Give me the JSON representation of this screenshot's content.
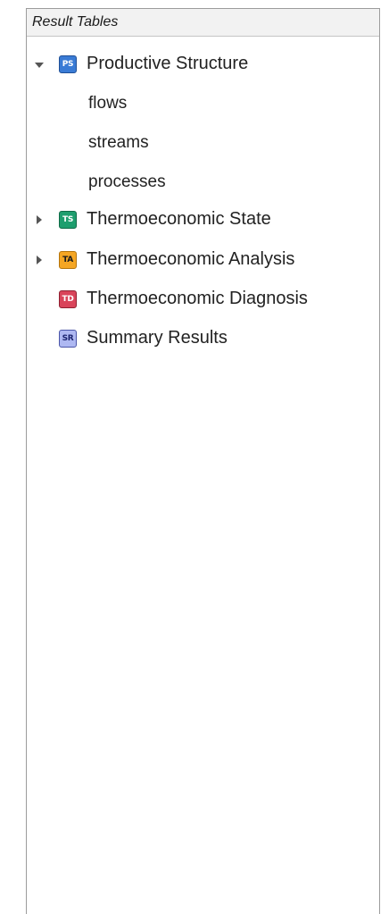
{
  "panel": {
    "title": "Result Tables"
  },
  "tree": {
    "productive_structure": {
      "badge": "PS",
      "label": "Productive Structure",
      "badge_bg": "#3a7bd5",
      "badge_border": "#1f4f96",
      "badge_fg": "#ffffff",
      "expanded": true,
      "children": [
        "flows",
        "streams",
        "processes"
      ]
    },
    "thermoeconomic_state": {
      "badge": "TS",
      "label": "Thermoeconomic State",
      "badge_bg": "#1e9e6e",
      "badge_border": "#0f6b47",
      "badge_fg": "#ffffff",
      "expanded": false
    },
    "thermoeconomic_analysis": {
      "badge": "TA",
      "label": "Thermoeconomic Analysis",
      "badge_bg": "#f5a623",
      "badge_border": "#b5740a",
      "badge_fg": "#1a1a1a",
      "expanded": false
    },
    "thermoeconomic_diagnosis": {
      "badge": "TD",
      "label": "Thermoeconomic Diagnosis",
      "badge_bg": "#d9445a",
      "badge_border": "#8f1f30",
      "badge_fg": "#ffffff"
    },
    "summary_results": {
      "badge": "SR",
      "label": "Summary Results",
      "badge_bg": "#aeb8f2",
      "badge_border": "#4a55a8",
      "badge_fg": "#1c2470"
    }
  }
}
